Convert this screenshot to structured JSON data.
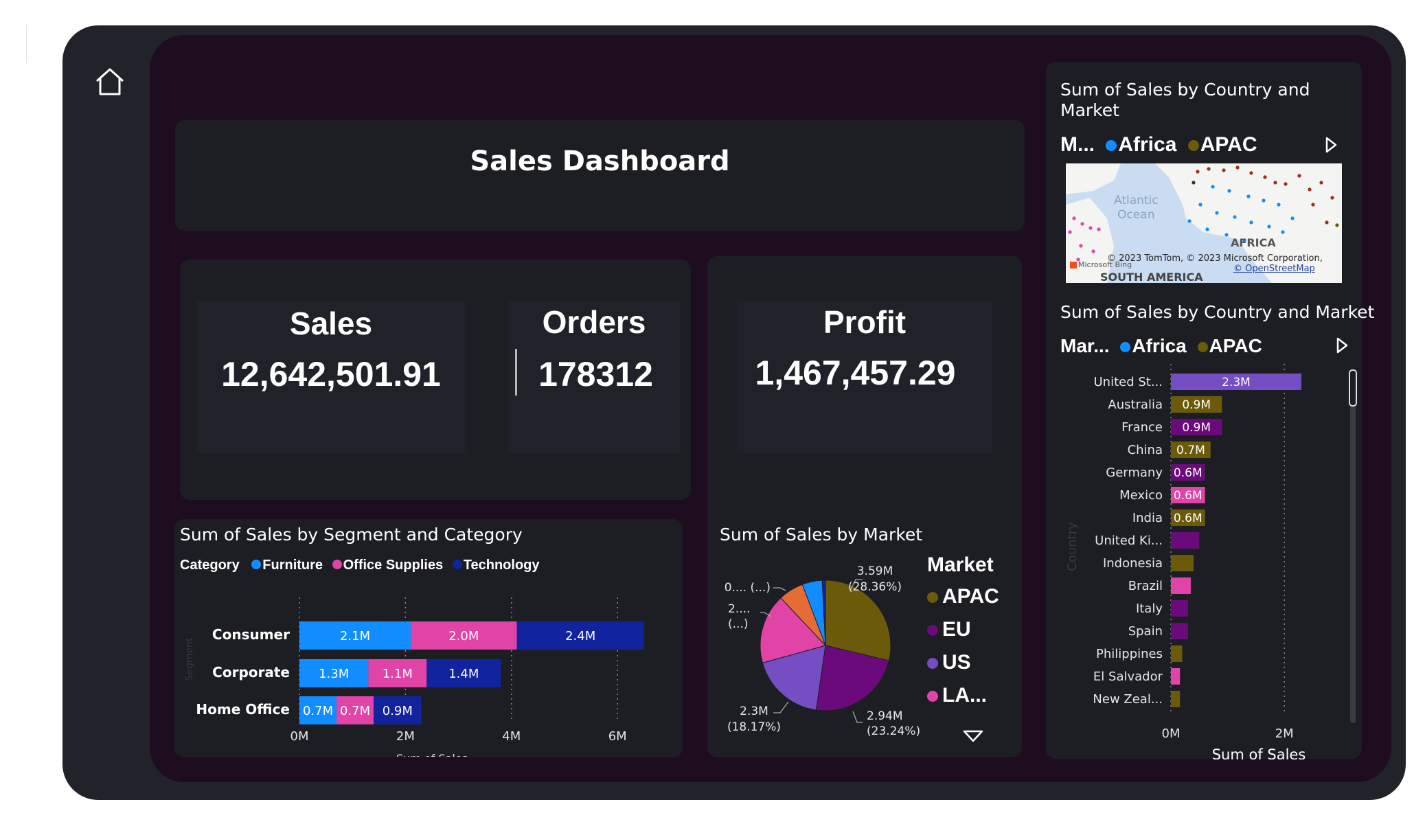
{
  "dashboard": {
    "title": "Sales Dashboard",
    "nav": {
      "home_icon": "home-icon"
    }
  },
  "kpis": {
    "sales_label": "Sales",
    "sales_value": "12,642,501.91",
    "orders_label": "Orders",
    "orders_value": "178312",
    "profit_label": "Profit",
    "profit_value": "1,467,457.29"
  },
  "segment_chart": {
    "title": "Sum of Sales by Segment and Category",
    "legend_label": "Category",
    "legend": [
      "Furniture",
      "Office Supplies",
      "Technology"
    ],
    "colors": [
      "#118dff",
      "#e044a7",
      "#12239e"
    ],
    "xlabel": "Sum of Sales",
    "ylabel": "Segment"
  },
  "market_pie": {
    "title": "Sum of Sales by Market",
    "legend_label": "Market",
    "legend": [
      "APAC",
      "EU",
      "US",
      "LA..."
    ],
    "legend_colors": [
      "#6b5a0a",
      "#6b0a7a",
      "#744ec2",
      "#e044a7"
    ],
    "labels": {
      "apac_value": "3.59M",
      "apac_pct": "(28.36%)",
      "eu_value": "2.94M",
      "eu_pct": "(23.24%)",
      "us_value": "2.3M",
      "us_pct": "(18.17%)",
      "small1": "0.... (...)",
      "small2_a": "2....",
      "small2_b": "(...)"
    }
  },
  "map_visual": {
    "title": "Sum of Sales by Country and Market",
    "legend_label": "M...",
    "legend": [
      "Africa",
      "APAC"
    ],
    "legend_colors": [
      "#118dff",
      "#6b5a0a"
    ],
    "ocean_label": "Atlantic Ocean",
    "ocean_line1": "Atlantic",
    "ocean_line2": "Ocean",
    "africa_label": "AFRICA",
    "south_america_label": "SOUTH AMERICA",
    "attribution": "© 2023 TomTom, © 2023 Microsoft Corporation,",
    "osm": "© OpenStreetMap",
    "bing": "Microsoft Bing"
  },
  "country_chart": {
    "title": "Sum of Sales by Country and Market",
    "legend_label": "Mar...",
    "legend": [
      "Africa",
      "APAC"
    ],
    "legend_colors": [
      "#118dff",
      "#6b5a0a"
    ],
    "xlabel": "Sum of Sales",
    "ylabel": "Country"
  },
  "chart_data": [
    {
      "type": "bar",
      "orientation": "horizontal-stacked",
      "title": "Sum of Sales by Segment and Category",
      "xlabel": "Sum of Sales",
      "ylabel": "Segment",
      "categories": [
        "Consumer",
        "Corporate",
        "Home Office"
      ],
      "series": [
        {
          "name": "Furniture",
          "values": [
            2.1,
            1.3,
            0.7
          ],
          "labels": [
            "2.1M",
            "1.3M",
            "0.7M"
          ]
        },
        {
          "name": "Office Supplies",
          "values": [
            2.0,
            1.1,
            0.7
          ],
          "labels": [
            "2.0M",
            "1.1M",
            "0.7M"
          ]
        },
        {
          "name": "Technology",
          "values": [
            2.4,
            1.4,
            0.9
          ],
          "labels": [
            "2.4M",
            "1.4M",
            "0.9M"
          ]
        }
      ],
      "xticks": [
        "0M",
        "2M",
        "4M",
        "6M"
      ],
      "xlim": [
        0,
        6.5
      ],
      "grid": true,
      "legend": "top-left"
    },
    {
      "type": "pie",
      "title": "Sum of Sales by Market",
      "slices": [
        {
          "name": "APAC",
          "value": 3.59,
          "percent": 28.36,
          "color": "#6b5a0a"
        },
        {
          "name": "EU",
          "value": 2.94,
          "percent": 23.24,
          "color": "#6b0a7a"
        },
        {
          "name": "US",
          "value": 2.3,
          "percent": 18.17,
          "color": "#744ec2"
        },
        {
          "name": "LA...",
          "value": 2.16,
          "percent": 17.1,
          "color": "#e044a7"
        },
        {
          "name": "",
          "value": 0.78,
          "percent": 6.2,
          "color": "#e66c37"
        },
        {
          "name": "",
          "value": 0.62,
          "percent": 4.9,
          "color": "#118dff"
        },
        {
          "name": "",
          "value": 0.1,
          "percent": 0.8,
          "color": "#12239e"
        }
      ],
      "legend": "right"
    },
    {
      "type": "bar",
      "orientation": "horizontal",
      "title": "Sum of Sales by Country and Market",
      "xlabel": "Sum of Sales",
      "ylabel": "Country",
      "categories": [
        "United St...",
        "Australia",
        "France",
        "China",
        "Germany",
        "Mexico",
        "India",
        "United Ki...",
        "Indonesia",
        "Brazil",
        "Italy",
        "Spain",
        "Philippines",
        "El Salvador",
        "New Zeal..."
      ],
      "values": [
        2.3,
        0.9,
        0.9,
        0.7,
        0.6,
        0.6,
        0.6,
        0.5,
        0.4,
        0.35,
        0.3,
        0.3,
        0.2,
        0.16,
        0.16
      ],
      "value_labels": [
        "2.3M",
        "0.9M",
        "0.9M",
        "0.7M",
        "0.6M",
        "0.6M",
        "0.6M",
        "",
        "",
        "",
        "",
        "",
        "",
        "",
        ""
      ],
      "colors": [
        "#744ec2",
        "#6b5a0a",
        "#6b0a7a",
        "#6b5a0a",
        "#6b0a7a",
        "#e044a7",
        "#6b5a0a",
        "#6b0a7a",
        "#6b5a0a",
        "#e044a7",
        "#6b0a7a",
        "#6b0a7a",
        "#6b5a0a",
        "#e044a7",
        "#6b5a0a"
      ],
      "xticks": [
        "0M",
        "2M"
      ],
      "xlim": [
        0,
        2.8
      ],
      "grid": true
    }
  ]
}
